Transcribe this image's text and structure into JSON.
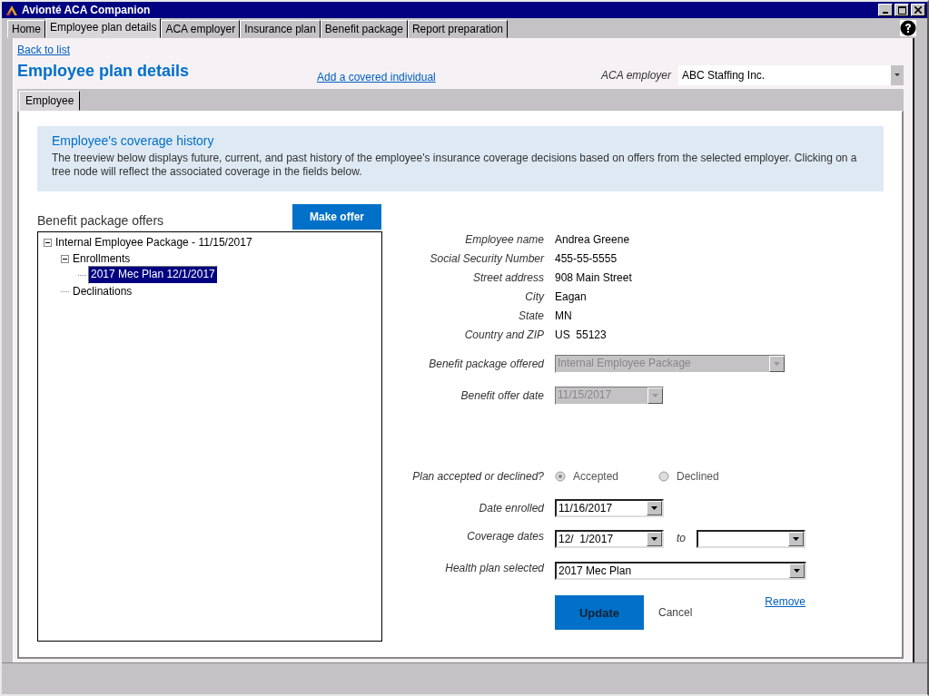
{
  "window": {
    "title": "Avionté ACA Companion"
  },
  "tabs": [
    {
      "label": "Home",
      "selected": false
    },
    {
      "label": "Employee plan details",
      "selected": true
    },
    {
      "label": "ACA employer",
      "selected": false
    },
    {
      "label": "Insurance plan",
      "selected": false
    },
    {
      "label": "Benefit package",
      "selected": false
    },
    {
      "label": "Report preparation",
      "selected": false
    }
  ],
  "back_link": "Back to list",
  "page_title": "Employee plan details",
  "add_link": "Add a covered individual",
  "employer": {
    "label": "ACA employer",
    "value": "ABC Staffing Inc."
  },
  "inner_tabs": [
    {
      "label": "Employee",
      "selected": true
    }
  ],
  "info": {
    "title": "Employee's coverage history",
    "text": "The treeview below displays future, current, and past history of the employee's insurance coverage decisions based on offers from the selected employer. Clicking on a tree node will reflect the associated coverage in the fields below."
  },
  "offers": {
    "title": "Benefit package offers",
    "button": "Make offer",
    "tree": [
      {
        "label": "Internal Employee Package - 11/15/2017",
        "expanded": true,
        "selected": false,
        "children": [
          {
            "label": "Enrollments",
            "expanded": true,
            "selected": false,
            "children": [
              {
                "label": "2017 Mec Plan 12/1/2017",
                "selected": true
              }
            ]
          },
          {
            "label": "Declinations",
            "selected": false
          }
        ]
      }
    ]
  },
  "details": [
    {
      "label": "Employee name",
      "value": "Andrea Greene"
    },
    {
      "label": "Social Security Number",
      "value": "455-55-5555"
    },
    {
      "label": "Street address",
      "value": "908 Main Street"
    },
    {
      "label": "City",
      "value": "Eagan"
    },
    {
      "label": "State",
      "value": "MN"
    },
    {
      "label": "Country and ZIP",
      "value": "US  55123"
    }
  ],
  "package": {
    "label": "Benefit package offered",
    "value": "Internal Employee Package",
    "disabled": true
  },
  "offer_date": {
    "label": "Benefit offer date",
    "value": "11/15/2017",
    "disabled": true
  },
  "decision": {
    "label": "Plan accepted or declined?",
    "disabled": true,
    "options": [
      {
        "label": "Accepted",
        "selected": true
      },
      {
        "label": "Declined",
        "selected": false
      }
    ]
  },
  "date_enrolled": {
    "label": "Date enrolled",
    "value": "11/16/2017",
    "disabled": false
  },
  "coverage": {
    "label": "Coverage dates",
    "from": "12/  1/2017",
    "to_label": "to"
  },
  "health_plan": {
    "label": "Health plan selected",
    "value": "2017 Mec Plan",
    "disabled": false
  },
  "actions": {
    "update": "Update",
    "cancel": "Cancel",
    "remove": "Remove"
  }
}
